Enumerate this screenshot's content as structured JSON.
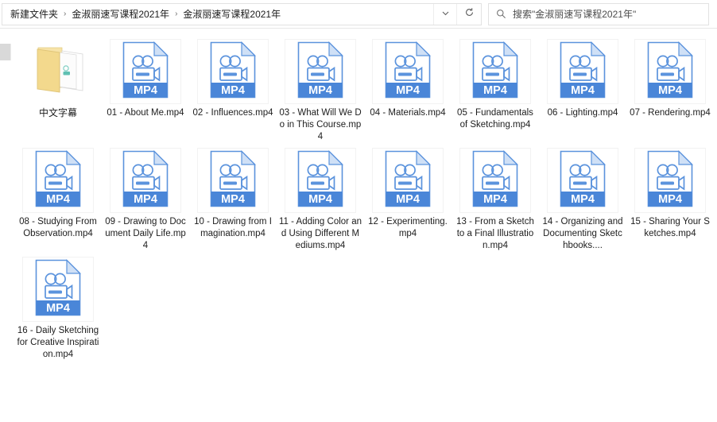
{
  "window": {
    "type": "file-explorer"
  },
  "addressbar": {
    "crumbs": [
      "新建文件夹",
      "金淑丽速写课程2021年",
      "金淑丽速写课程2021年"
    ],
    "separator": "›",
    "dropdown_icon": "chevron-down-icon",
    "refresh_icon": "refresh-icon",
    "refresh_glyph": "↻"
  },
  "search": {
    "icon": "search-icon",
    "placeholder": "搜索\"金淑丽速写课程2021年\"",
    "value": ""
  },
  "colors": {
    "accent_blue": "#4a86d8",
    "icon_outline": "#5b93dd",
    "folder_yellow": "#f5d98a",
    "folder_yellow_dark": "#e8c96f",
    "text": "#1d1d1d",
    "tile_border": "#f2f2f2",
    "toolbar_border": "#e6e6e6"
  },
  "items": [
    {
      "name": "中文字幕",
      "kind": "folder",
      "icon": "folder-open-icon",
      "cjk": true
    },
    {
      "name": "01 - About Me.mp4",
      "kind": "mp4",
      "icon": "mp4-file-icon",
      "badge": "MP4"
    },
    {
      "name": "02 - Influences.mp4",
      "kind": "mp4",
      "icon": "mp4-file-icon",
      "badge": "MP4"
    },
    {
      "name": "03 - What Will We Do in This Course.mp4",
      "kind": "mp4",
      "icon": "mp4-file-icon",
      "badge": "MP4"
    },
    {
      "name": "04 - Materials.mp4",
      "kind": "mp4",
      "icon": "mp4-file-icon",
      "badge": "MP4"
    },
    {
      "name": "05 - Fundamentals of Sketching.mp4",
      "kind": "mp4",
      "icon": "mp4-file-icon",
      "badge": "MP4"
    },
    {
      "name": "06 - Lighting.mp4",
      "kind": "mp4",
      "icon": "mp4-file-icon",
      "badge": "MP4"
    },
    {
      "name": "07 - Rendering.mp4",
      "kind": "mp4",
      "icon": "mp4-file-icon",
      "badge": "MP4"
    },
    {
      "name": "08 - Studying From Observation.mp4",
      "kind": "mp4",
      "icon": "mp4-file-icon",
      "badge": "MP4"
    },
    {
      "name": "09 - Drawing to Document Daily Life.mp4",
      "kind": "mp4",
      "icon": "mp4-file-icon",
      "badge": "MP4"
    },
    {
      "name": "10 - Drawing from Imagination.mp4",
      "kind": "mp4",
      "icon": "mp4-file-icon",
      "badge": "MP4"
    },
    {
      "name": "11 - Adding Color and Using Different Mediums.mp4",
      "kind": "mp4",
      "icon": "mp4-file-icon",
      "badge": "MP4"
    },
    {
      "name": "12 - Experimenting.mp4",
      "kind": "mp4",
      "icon": "mp4-file-icon",
      "badge": "MP4"
    },
    {
      "name": "13 - From a Sketch to a Final Illustration.mp4",
      "kind": "mp4",
      "icon": "mp4-file-icon",
      "badge": "MP4"
    },
    {
      "name": "14 - Organizing and Documenting Sketchbooks....",
      "kind": "mp4",
      "icon": "mp4-file-icon",
      "badge": "MP4"
    },
    {
      "name": "15 - Sharing Your Sketches.mp4",
      "kind": "mp4",
      "icon": "mp4-file-icon",
      "badge": "MP4"
    },
    {
      "name": "16 - Daily Sketching for Creative Inspiration.mp4",
      "kind": "mp4",
      "icon": "mp4-file-icon",
      "badge": "MP4"
    }
  ]
}
